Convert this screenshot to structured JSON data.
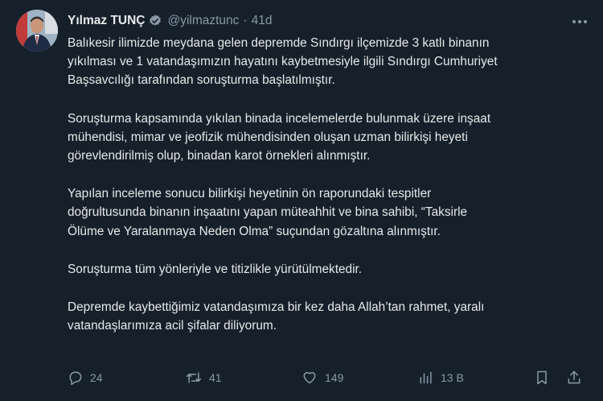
{
  "author": {
    "name": "Yılmaz TUNÇ",
    "handle": "@yilmaztunc",
    "separator": "·",
    "time": "41d"
  },
  "tweet": {
    "paragraphs": [
      [
        "Balıkesir ilimizde meydana gelen depremde Sındırgı ilçemizde 3 katlı binanın",
        "yıkılması ve 1 vatandaşımızın hayatını kaybetmesiyle ilgili Sındırgı Cumhuriyet",
        "Başsavcılığı tarafından soruşturma başlatılmıştır."
      ],
      [
        "Soruşturma kapsamında yıkılan binada incelemelerde bulunmak üzere inşaat",
        "mühendisi, mimar ve jeofizik mühendisinden oluşan uzman bilirkişi heyeti",
        "görevlendirilmiş olup, binadan karot örnekleri alınmıştır."
      ],
      [
        "Yapılan inceleme sonucu bilirkişi heyetinin ön raporundaki tespitler",
        "doğrultusunda binanın inşaatını yapan müteahhit ve bina sahibi, “Taksirle",
        "Ölüme ve Yaralanmaya Neden Olma” suçundan gözaltına alınmıştır."
      ],
      [
        "Soruşturma tüm yönleriyle ve titizlikle yürütülmektedir."
      ],
      [
        "Depremde kaybettiğimiz vatandaşımıza bir kez daha Allah’tan rahmet, yaralı",
        "vatandaşlarımıza acil şifalar diliyorum."
      ]
    ]
  },
  "metrics": {
    "replies": "24",
    "reposts": "41",
    "likes": "149",
    "views": "13 B"
  },
  "colors": {
    "background": "#15202b",
    "text": "#e7e9ea",
    "secondary": "#8b98a5",
    "verified_badge": "#8b98a5"
  },
  "icons": [
    "avatar",
    "verified-badge-icon",
    "more-icon",
    "reply-icon",
    "repost-icon",
    "like-icon",
    "views-icon",
    "bookmark-icon",
    "share-icon"
  ]
}
